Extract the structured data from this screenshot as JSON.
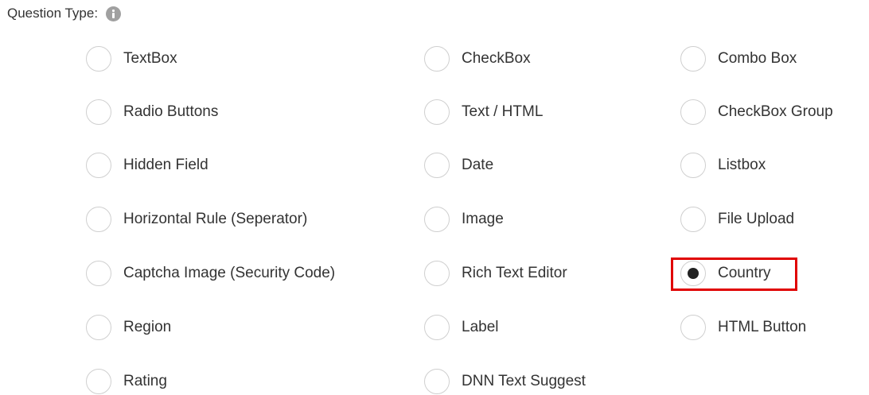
{
  "header": {
    "label": "Question Type:",
    "icon": "info-icon"
  },
  "options": [
    [
      "TextBox",
      "CheckBox",
      "Combo Box"
    ],
    [
      "Radio Buttons",
      "Text / HTML",
      "CheckBox Group"
    ],
    [
      "Hidden Field",
      "Date",
      "Listbox"
    ],
    [
      "Horizontal Rule (Seperator)",
      "Image",
      "File Upload"
    ],
    [
      "Captcha Image (Security Code)",
      "Rich Text Editor",
      "Country"
    ],
    [
      "Region",
      "Label",
      "HTML Button"
    ],
    [
      "Rating",
      "DNN Text Suggest",
      ""
    ]
  ],
  "selected": "Country",
  "highlight_color": "#e00000"
}
